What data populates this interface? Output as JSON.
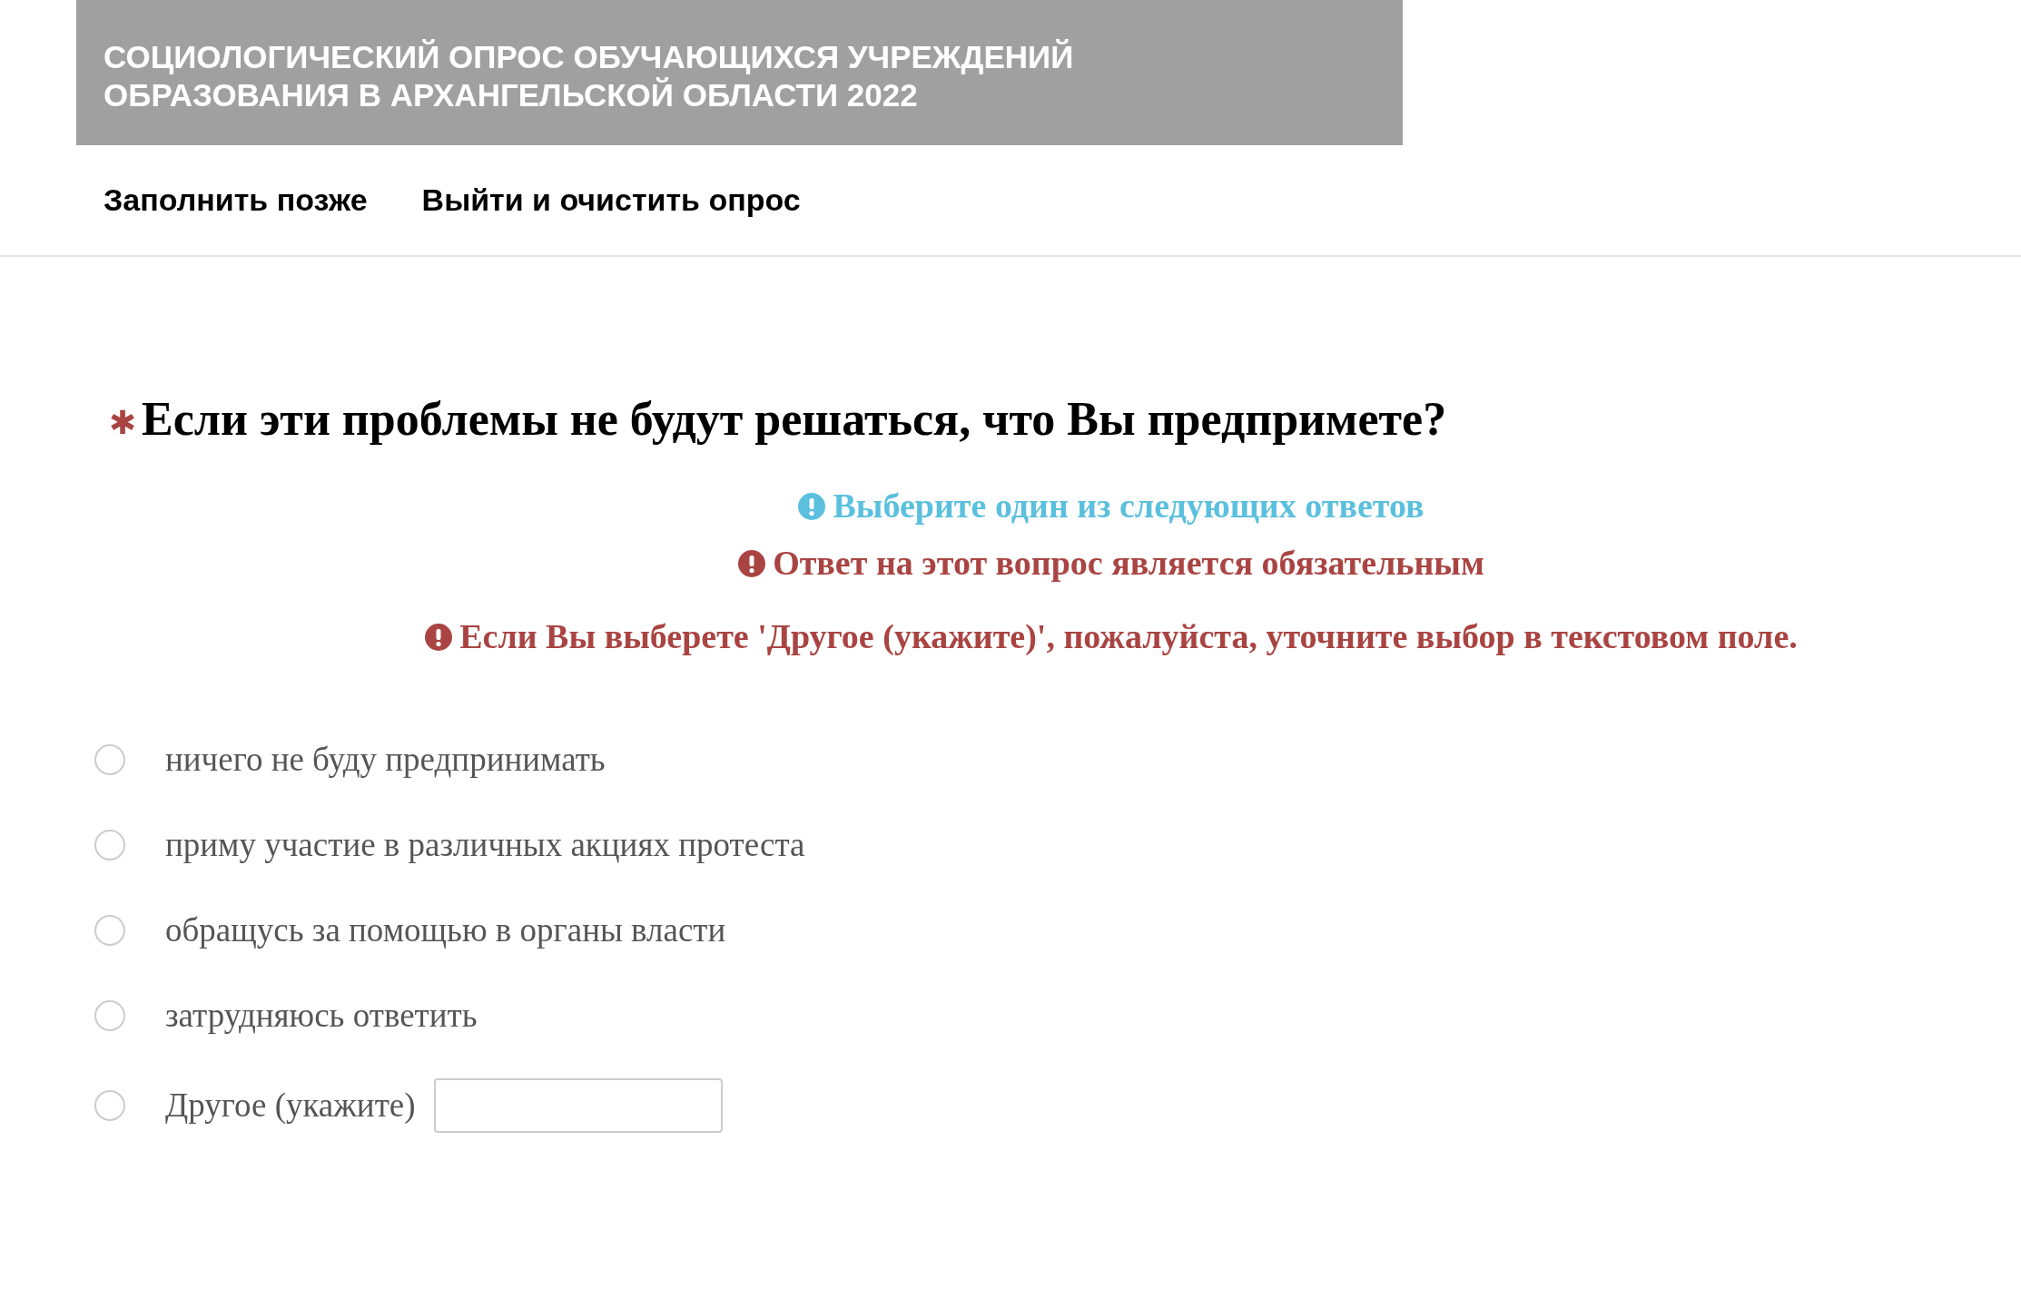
{
  "header": {
    "title_lines": [
      "СОЦИОЛОГИЧЕСКИЙ ОПРОС ОБУЧАЮЩИХСЯ УЧРЕЖДЕНИЙ",
      "ОБРАЗОВАНИЯ В АРХАНГЕЛЬСКОЙ ОБЛАСТИ 2022"
    ]
  },
  "nav": [
    "Заполнить позже",
    "Выйти и очистить опрос"
  ],
  "question": {
    "required_mark": "✱",
    "text": "Если эти проблемы не будут решаться, что Вы предпримете?"
  },
  "hints": [
    {
      "kind": "info",
      "text": "Выберите один из следующих ответов"
    },
    {
      "kind": "error",
      "text": "Ответ на этот вопрос является обязательным"
    },
    {
      "kind": "error",
      "text": "Если Вы выберете 'Другое (укажите)', пожалуйста, уточните выбор в текстовом поле."
    }
  ],
  "options": [
    {
      "kind": "plain",
      "label": "ничего не буду предпринимать",
      "selected": false
    },
    {
      "kind": "plain",
      "label": "приму участие в различных акциях протеста",
      "selected": false
    },
    {
      "kind": "plain",
      "label": "обращусь за помощью в органы власти",
      "selected": false
    },
    {
      "kind": "plain",
      "label": "затрудняюсь ответить",
      "selected": false
    },
    {
      "kind": "other",
      "label": "Другое (укажите)",
      "selected": false
    }
  ]
}
